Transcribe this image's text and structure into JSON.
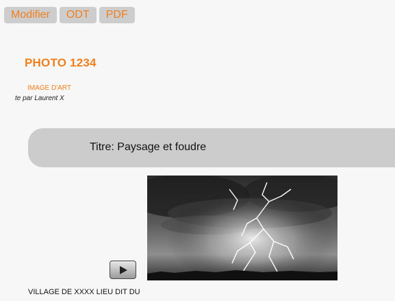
{
  "toolbar": {
    "buttons": [
      {
        "label": "Modifier"
      },
      {
        "label": "ODT"
      },
      {
        "label": "PDF"
      }
    ]
  },
  "record": {
    "title": "PHOTO 1234",
    "type": "IMAGE D'ART",
    "credit": "te par Laurent X",
    "heading": "Titre: Paysage et foudre",
    "caption": "VILLAGE DE XXXX LIEU DIT DU"
  },
  "media": {
    "icon": "play-icon"
  },
  "colors": {
    "accent": "#f07f1e",
    "button_bg": "#cdcdcd",
    "band_bg": "#cccccc"
  }
}
